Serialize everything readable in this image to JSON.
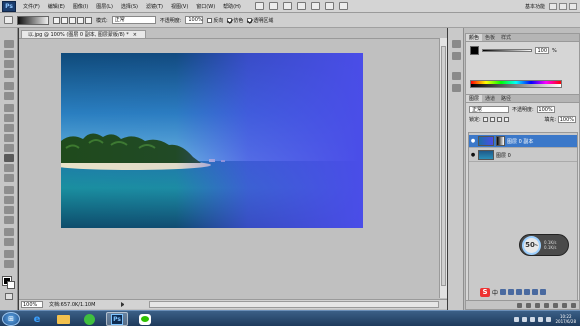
{
  "menubar": {
    "logo": "Ps",
    "items": [
      "文件(F)",
      "编辑(E)",
      "图像(I)",
      "图层(L)",
      "选择(S)",
      "滤镜(T)",
      "视图(V)",
      "窗口(W)",
      "帮助(H)"
    ],
    "workspace": "基本功能"
  },
  "optionsbar": {
    "mode_label": "模式:",
    "mode_value": "正常",
    "opacity_label": "不透明度:",
    "opacity_value": "100%",
    "reverse_label": "反向",
    "dither_label": "仿色",
    "transparency_label": "透明区域"
  },
  "document": {
    "tab_title": "以.jpg @ 100% (图层 0 副本, 图层蒙版/8) *",
    "tab_close": "×",
    "zoom": "100%",
    "doc_info": "文档:657.0K/1.10M"
  },
  "panels": {
    "color_tabs": [
      "颜色",
      "色板",
      "样式"
    ],
    "color_value": "100",
    "color_unit": "%",
    "layers_tabs": [
      "图层",
      "通道",
      "路径"
    ],
    "blend_mode": "正常",
    "opacity_label": "不透明度:",
    "opacity_value": "100%",
    "lock_label": "锁定:",
    "fill_label": "填充:",
    "fill_value": "100%",
    "layers": [
      {
        "name": "图层 0 副本",
        "selected": true
      },
      {
        "name": "图层 0",
        "selected": false
      }
    ]
  },
  "speed_widget": {
    "value": "50",
    "unit": "%",
    "up": "0.1K/s",
    "down": "0.1K/s"
  },
  "ime": {
    "brand": "S",
    "lang": "中"
  },
  "taskbar": {
    "time": "10:22",
    "date": "2017/6/28"
  },
  "colors": {
    "accent_selected": "#3b78c9",
    "ps_blue": "#1b3d6e"
  }
}
